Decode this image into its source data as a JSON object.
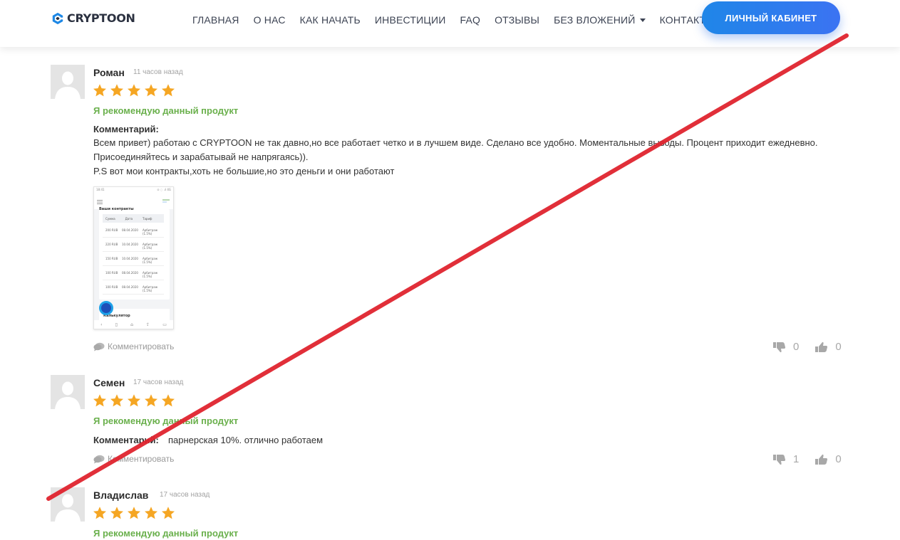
{
  "header": {
    "logo_text": "CRYPTOON",
    "nav": [
      {
        "label": "ГЛАВНАЯ"
      },
      {
        "label": "О НАС"
      },
      {
        "label": "КАК НАЧАТЬ"
      },
      {
        "label": "ИНВЕСТИЦИИ"
      },
      {
        "label": "FAQ"
      },
      {
        "label": "ОТЗЫВЫ"
      },
      {
        "label": "БЕЗ ВЛОЖЕНИЙ"
      },
      {
        "label": "КОНТАКТЫ"
      }
    ],
    "cabinet_button": "ЛИЧНЫЙ КАБИНЕТ"
  },
  "reviews": [
    {
      "author": "Роман",
      "time": "11 часов назад",
      "rating": 5,
      "recommend": "Я рекомендую данный продукт",
      "comment_label": "Комментарий:",
      "comment_lines": [
        "Всем привет) работаю с CRYPTOON не так давно,но все работает четко и в лучшем виде. Сделано все удобно. Моментальные выводы. Процент приходит ежедневно.",
        "Присоединяйтесь и зарабатывай не напрягаясь)).",
        "P.S вот мои контракты,хоть не большие,но это деньги и они работают"
      ],
      "attachment": {
        "status_left": "18:41",
        "status_right": "⊙ ◌ .ıl 4G",
        "title": "Ваши контракты",
        "columns": [
          "Сумма",
          "Дата",
          "Тариф"
        ],
        "rows": [
          [
            "200 RUB",
            "08.04.2020",
            "Арбитраж (1.5%)"
          ],
          [
            "220 RUB",
            "10.04.2020",
            "Арбитраж (1.5%)"
          ],
          [
            "150 RUB",
            "10.04.2020",
            "Арбитраж (1.5%)"
          ],
          [
            "100 RUB",
            "08.04.2020",
            "Арбитраж (1.5%)"
          ],
          [
            "100 RUB",
            "08.04.2020",
            "Арбитраж (1.5%)"
          ]
        ],
        "calculator": "Калькулятор"
      },
      "reply_label": "Комментировать",
      "dislikes": "0",
      "likes": "0"
    },
    {
      "author": "Семен",
      "time": "17 часов назад",
      "rating": 5,
      "recommend": "Я рекомендую данный продукт",
      "comment_label": "Комментарий:",
      "comment_text": "парнерская 10%. отлично работаем",
      "reply_label": "Комментировать",
      "dislikes": "1",
      "likes": "0"
    },
    {
      "author": "Владислав",
      "time": "17 часов назад",
      "rating": 5,
      "recommend": "Я рекомендую данный продукт"
    }
  ],
  "colors": {
    "accent": "#2f7ef0",
    "recommend_green": "#6ab04c",
    "star": "#f5a623",
    "cross_line": "#e0242f"
  },
  "icons": [
    "cryptoon-logo-icon",
    "user-avatar-icon",
    "star-icon",
    "comment-icon",
    "thumbs-down-icon",
    "thumbs-up-icon",
    "caret-down-icon"
  ]
}
